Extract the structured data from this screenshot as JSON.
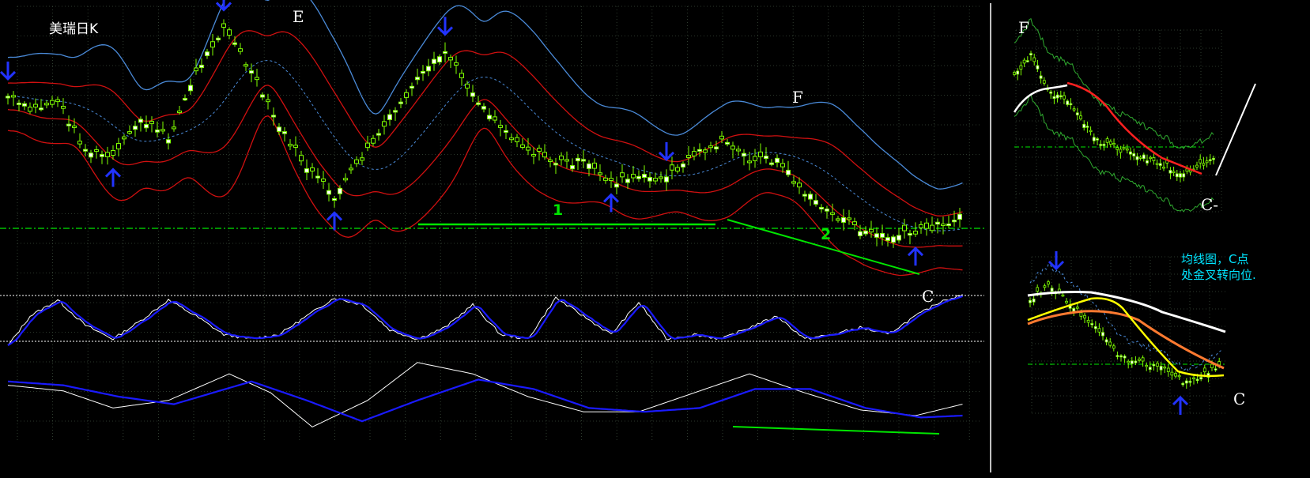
{
  "title": "美瑞日K",
  "colors": {
    "background": "#000000",
    "grid": "#3a4a3a",
    "candle": "#7fff00",
    "arrow": "#2233ff",
    "band_outer": "#4a8ad8",
    "band_inner": "#d01010",
    "trendline": "#00e600",
    "signal_blue": "#1a1aff",
    "line_white": "#ffffff",
    "ma_red": "#ff2020",
    "ma_yellow": "#ffff00",
    "ma_orange": "#ff7a30",
    "annotation_cyan": "#00e5ff"
  },
  "main": {
    "labels": {
      "E": "E",
      "F": "F",
      "C": "C",
      "line1": "1",
      "line2": "2"
    }
  },
  "inset_top": {
    "labels": {
      "F": "F",
      "C": "C-"
    }
  },
  "inset_bottom": {
    "labels": {
      "C": "C"
    },
    "note_line1": "均线图，C点",
    "note_line2": "处金叉转向位."
  },
  "chart_data": [
    {
      "type": "line",
      "panel": "main-candlestick",
      "title": "美瑞日K",
      "price_waypoints": [
        [
          0,
          122
        ],
        [
          8,
          140
        ],
        [
          18,
          128
        ],
        [
          28,
          190
        ],
        [
          38,
          200
        ],
        [
          48,
          150
        ],
        [
          58,
          175
        ],
        [
          68,
          92
        ],
        [
          78,
          32
        ],
        [
          88,
          92
        ],
        [
          98,
          160
        ],
        [
          108,
          212
        ],
        [
          118,
          248
        ],
        [
          128,
          200
        ],
        [
          138,
          150
        ],
        [
          148,
          102
        ],
        [
          158,
          65
        ],
        [
          168,
          118
        ],
        [
          178,
          160
        ],
        [
          188,
          190
        ],
        [
          198,
          205
        ],
        [
          208,
          205
        ],
        [
          218,
          230
        ],
        [
          228,
          225
        ],
        [
          238,
          225
        ],
        [
          248,
          195
        ],
        [
          258,
          180
        ],
        [
          268,
          200
        ],
        [
          278,
          202
        ],
        [
          288,
          245
        ],
        [
          298,
          270
        ],
        [
          308,
          290
        ],
        [
          318,
          300
        ],
        [
          328,
          295
        ],
        [
          338,
          282
        ],
        [
          345,
          275
        ]
      ],
      "arrows_down": [
        0,
        78,
        158,
        238
      ],
      "arrows_up": [
        38,
        118,
        218,
        328
      ],
      "annotations": [
        "E",
        "F",
        "C",
        "1",
        "2"
      ]
    },
    {
      "type": "line",
      "panel": "stochastic",
      "series": [
        {
          "color": "white",
          "waypoints": [
            [
              0,
              -0.1
            ],
            [
              8,
              0.55
            ],
            [
              18,
              0.9
            ],
            [
              28,
              0.35
            ],
            [
              38,
              0.05
            ],
            [
              48,
              0.45
            ],
            [
              58,
              0.9
            ],
            [
              68,
              0.55
            ],
            [
              78,
              0.15
            ],
            [
              88,
              0.05
            ],
            [
              98,
              0.15
            ],
            [
              108,
              0.55
            ],
            [
              118,
              0.95
            ],
            [
              128,
              0.8
            ],
            [
              138,
              0.25
            ],
            [
              148,
              0.05
            ],
            [
              158,
              0.3
            ],
            [
              168,
              0.8
            ],
            [
              178,
              0.15
            ],
            [
              188,
              0.05
            ],
            [
              198,
              0.95
            ],
            [
              208,
              0.55
            ],
            [
              218,
              0.15
            ],
            [
              228,
              0.85
            ],
            [
              238,
              0.05
            ],
            [
              248,
              0.15
            ],
            [
              258,
              0.05
            ],
            [
              268,
              0.3
            ],
            [
              278,
              0.55
            ],
            [
              288,
              0.05
            ],
            [
              298,
              0.15
            ],
            [
              308,
              0.3
            ],
            [
              318,
              0.15
            ],
            [
              328,
              0.55
            ],
            [
              338,
              0.9
            ],
            [
              345,
              1.0
            ]
          ]
        }
      ]
    },
    {
      "type": "line",
      "panel": "macd",
      "series": [
        {
          "color": "white",
          "waypoints": [
            [
              0,
              -0.2
            ],
            [
              20,
              -0.35
            ],
            [
              38,
              -0.8
            ],
            [
              58,
              -0.6
            ],
            [
              80,
              0.1
            ],
            [
              95,
              -0.4
            ],
            [
              110,
              -1.3
            ],
            [
              130,
              -0.6
            ],
            [
              148,
              0.4
            ],
            [
              168,
              0.1
            ],
            [
              188,
              -0.5
            ],
            [
              208,
              -0.9
            ],
            [
              228,
              -0.9
            ],
            [
              248,
              -0.4
            ],
            [
              268,
              0.1
            ],
            [
              288,
              -0.4
            ],
            [
              308,
              -0.85
            ],
            [
              328,
              -1.0
            ],
            [
              345,
              -0.7
            ]
          ]
        },
        {
          "color": "blue",
          "waypoints": [
            [
              0,
              -0.1
            ],
            [
              20,
              -0.2
            ],
            [
              40,
              -0.5
            ],
            [
              60,
              -0.7
            ],
            [
              88,
              -0.1
            ],
            [
              108,
              -0.6
            ],
            [
              128,
              -1.15
            ],
            [
              148,
              -0.6
            ],
            [
              170,
              -0.05
            ],
            [
              190,
              -0.3
            ],
            [
              210,
              -0.8
            ],
            [
              230,
              -0.9
            ],
            [
              250,
              -0.8
            ],
            [
              270,
              -0.3
            ],
            [
              290,
              -0.3
            ],
            [
              310,
              -0.8
            ],
            [
              330,
              -1.05
            ],
            [
              345,
              -1.0
            ]
          ]
        }
      ]
    },
    {
      "type": "line",
      "panel": "inset-top",
      "price_waypoints": [
        [
          0,
          50
        ],
        [
          10,
          20
        ],
        [
          22,
          70
        ],
        [
          35,
          85
        ],
        [
          50,
          130
        ],
        [
          62,
          140
        ],
        [
          75,
          150
        ],
        [
          90,
          160
        ],
        [
          100,
          172
        ],
        [
          110,
          165
        ],
        [
          120,
          150
        ]
      ],
      "annotations": [
        "F",
        "C-"
      ]
    },
    {
      "type": "line",
      "panel": "inset-bottom",
      "price_waypoints": [
        [
          0,
          45
        ],
        [
          10,
          25
        ],
        [
          22,
          50
        ],
        [
          35,
          75
        ],
        [
          50,
          118
        ],
        [
          62,
          125
        ],
        [
          75,
          132
        ],
        [
          85,
          150
        ],
        [
          95,
          138
        ],
        [
          105,
          128
        ]
      ],
      "annotations": [
        "C",
        "均线图，C点",
        "处金叉转向位."
      ]
    }
  ]
}
